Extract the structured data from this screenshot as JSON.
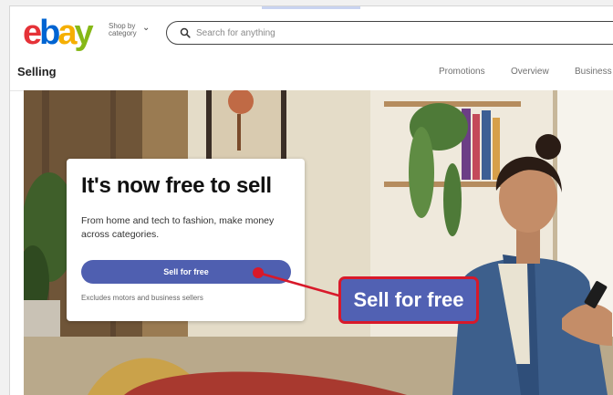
{
  "header": {
    "logo_letters": [
      "e",
      "b",
      "a",
      "y"
    ],
    "shop_by_category": "Shop by category",
    "search_placeholder": "Search for anything"
  },
  "subnav": {
    "title": "Selling",
    "links": [
      "Promotions",
      "Overview",
      "Business"
    ]
  },
  "hero_card": {
    "headline": "It's now free to sell",
    "body": "From home and tech to fashion, make money across categories.",
    "cta_label": "Sell for free",
    "fine_print": "Excludes motors and business sellers"
  },
  "annotation": {
    "callout_label": "Sell for free",
    "callout_color": "#5161b3",
    "pointer_color": "#d8192a"
  },
  "colors": {
    "brand_red": "#e53238",
    "brand_blue": "#0064d2",
    "brand_yellow": "#f5af02",
    "brand_green": "#86b817",
    "cta_blue": "#4f5fb0"
  }
}
